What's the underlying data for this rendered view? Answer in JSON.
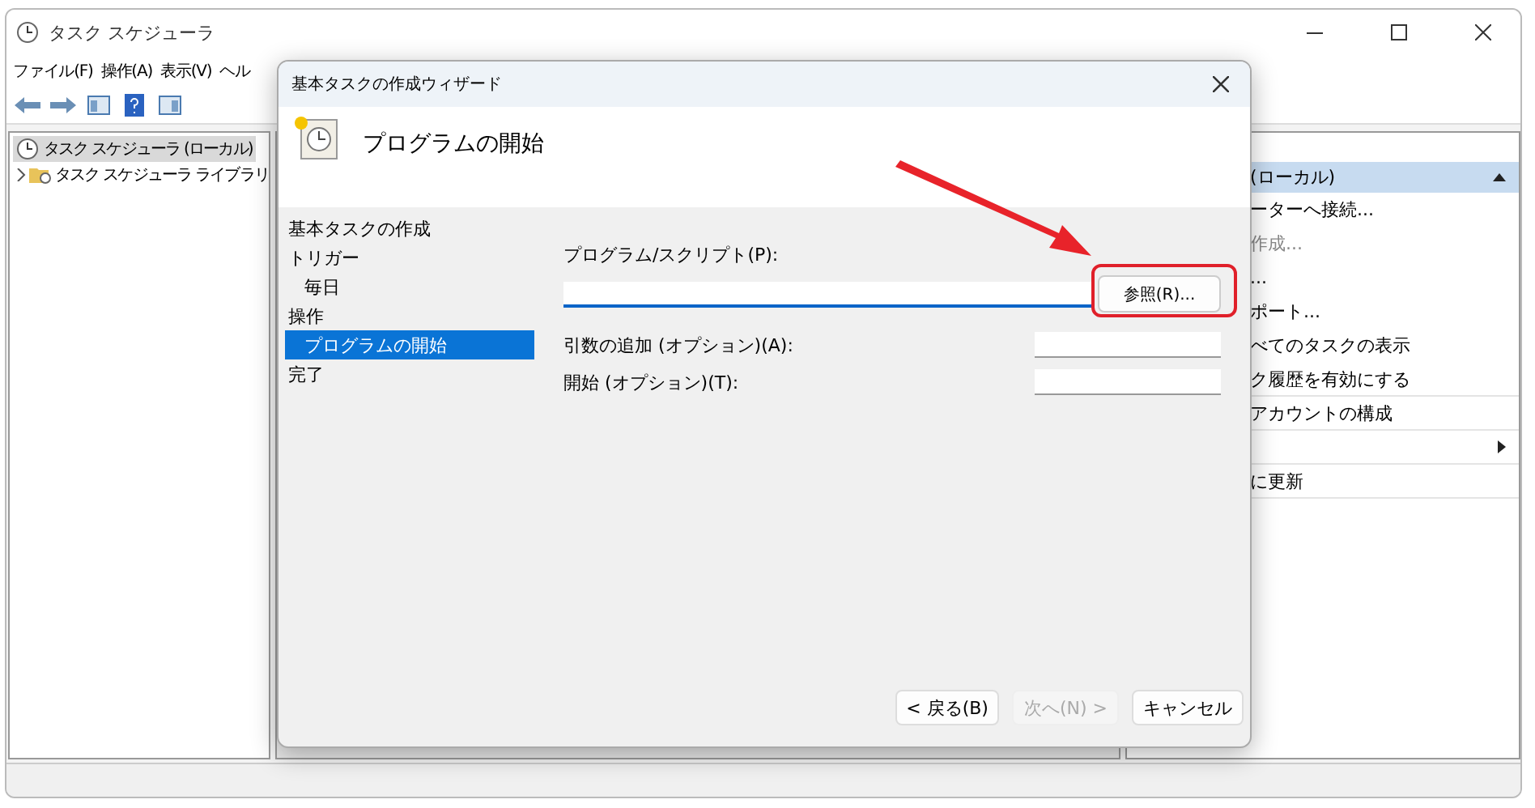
{
  "window": {
    "title": "タスク スケジューラ"
  },
  "menu": [
    {
      "label": "ファイル(F)"
    },
    {
      "label": "操作(A)"
    },
    {
      "label": "表示(V)"
    },
    {
      "label": "ヘル"
    }
  ],
  "tree": [
    {
      "label": "タスク スケジューラ (ローカル)",
      "selected": true,
      "children": [
        {
          "label": "タスク スケジューラ ライブラリ",
          "selected": false,
          "expanded": false
        }
      ]
    }
  ],
  "actions": {
    "header": "(ローカル)",
    "items": [
      {
        "kind": "text",
        "label": "ーターへ接続...",
        "disabled": false
      },
      {
        "kind": "text",
        "label": "作成...",
        "disabled": true
      },
      {
        "kind": "text",
        "label": "...",
        "disabled": false
      },
      {
        "kind": "text",
        "label": "ポート...",
        "disabled": false
      },
      {
        "kind": "text",
        "label": "べてのタスクの表示",
        "disabled": false
      },
      {
        "kind": "text",
        "label": "ク履歴を有効にする",
        "disabled": false
      },
      {
        "kind": "text",
        "label": "アカウントの構成",
        "disabled": false
      },
      {
        "kind": "submenu"
      },
      {
        "kind": "text",
        "label": "に更新",
        "disabled": false
      }
    ]
  },
  "dialog": {
    "title": "基本タスクの作成ウィザード",
    "heading": "プログラムの開始",
    "steps": [
      {
        "label": "基本タスクの作成",
        "selected": false
      },
      {
        "label": "トリガー",
        "selected": false,
        "children": [
          {
            "label": "毎日",
            "selected": false
          }
        ]
      },
      {
        "label": "操作",
        "selected": false,
        "children": [
          {
            "label": "プログラムの開始",
            "selected": true
          }
        ]
      },
      {
        "label": "完了",
        "selected": false
      }
    ],
    "fields": [
      {
        "kind": "wide",
        "label": "プログラム/スクリプト(P):",
        "focused": true
      },
      {
        "kind": "short",
        "label": "引数の追加 (オプション)(A):",
        "focused": false
      },
      {
        "kind": "short",
        "label": "開始 (オプション)(T):",
        "focused": false
      }
    ],
    "browse_button": "参照(R)...",
    "buttons": [
      {
        "label": "< 戻る(B)",
        "disabled": false
      },
      {
        "label": "次へ(N) >",
        "disabled": true
      },
      {
        "label": "キャンセル",
        "disabled": false
      }
    ]
  },
  "annotation": {
    "arrow": true,
    "highlight": true
  }
}
